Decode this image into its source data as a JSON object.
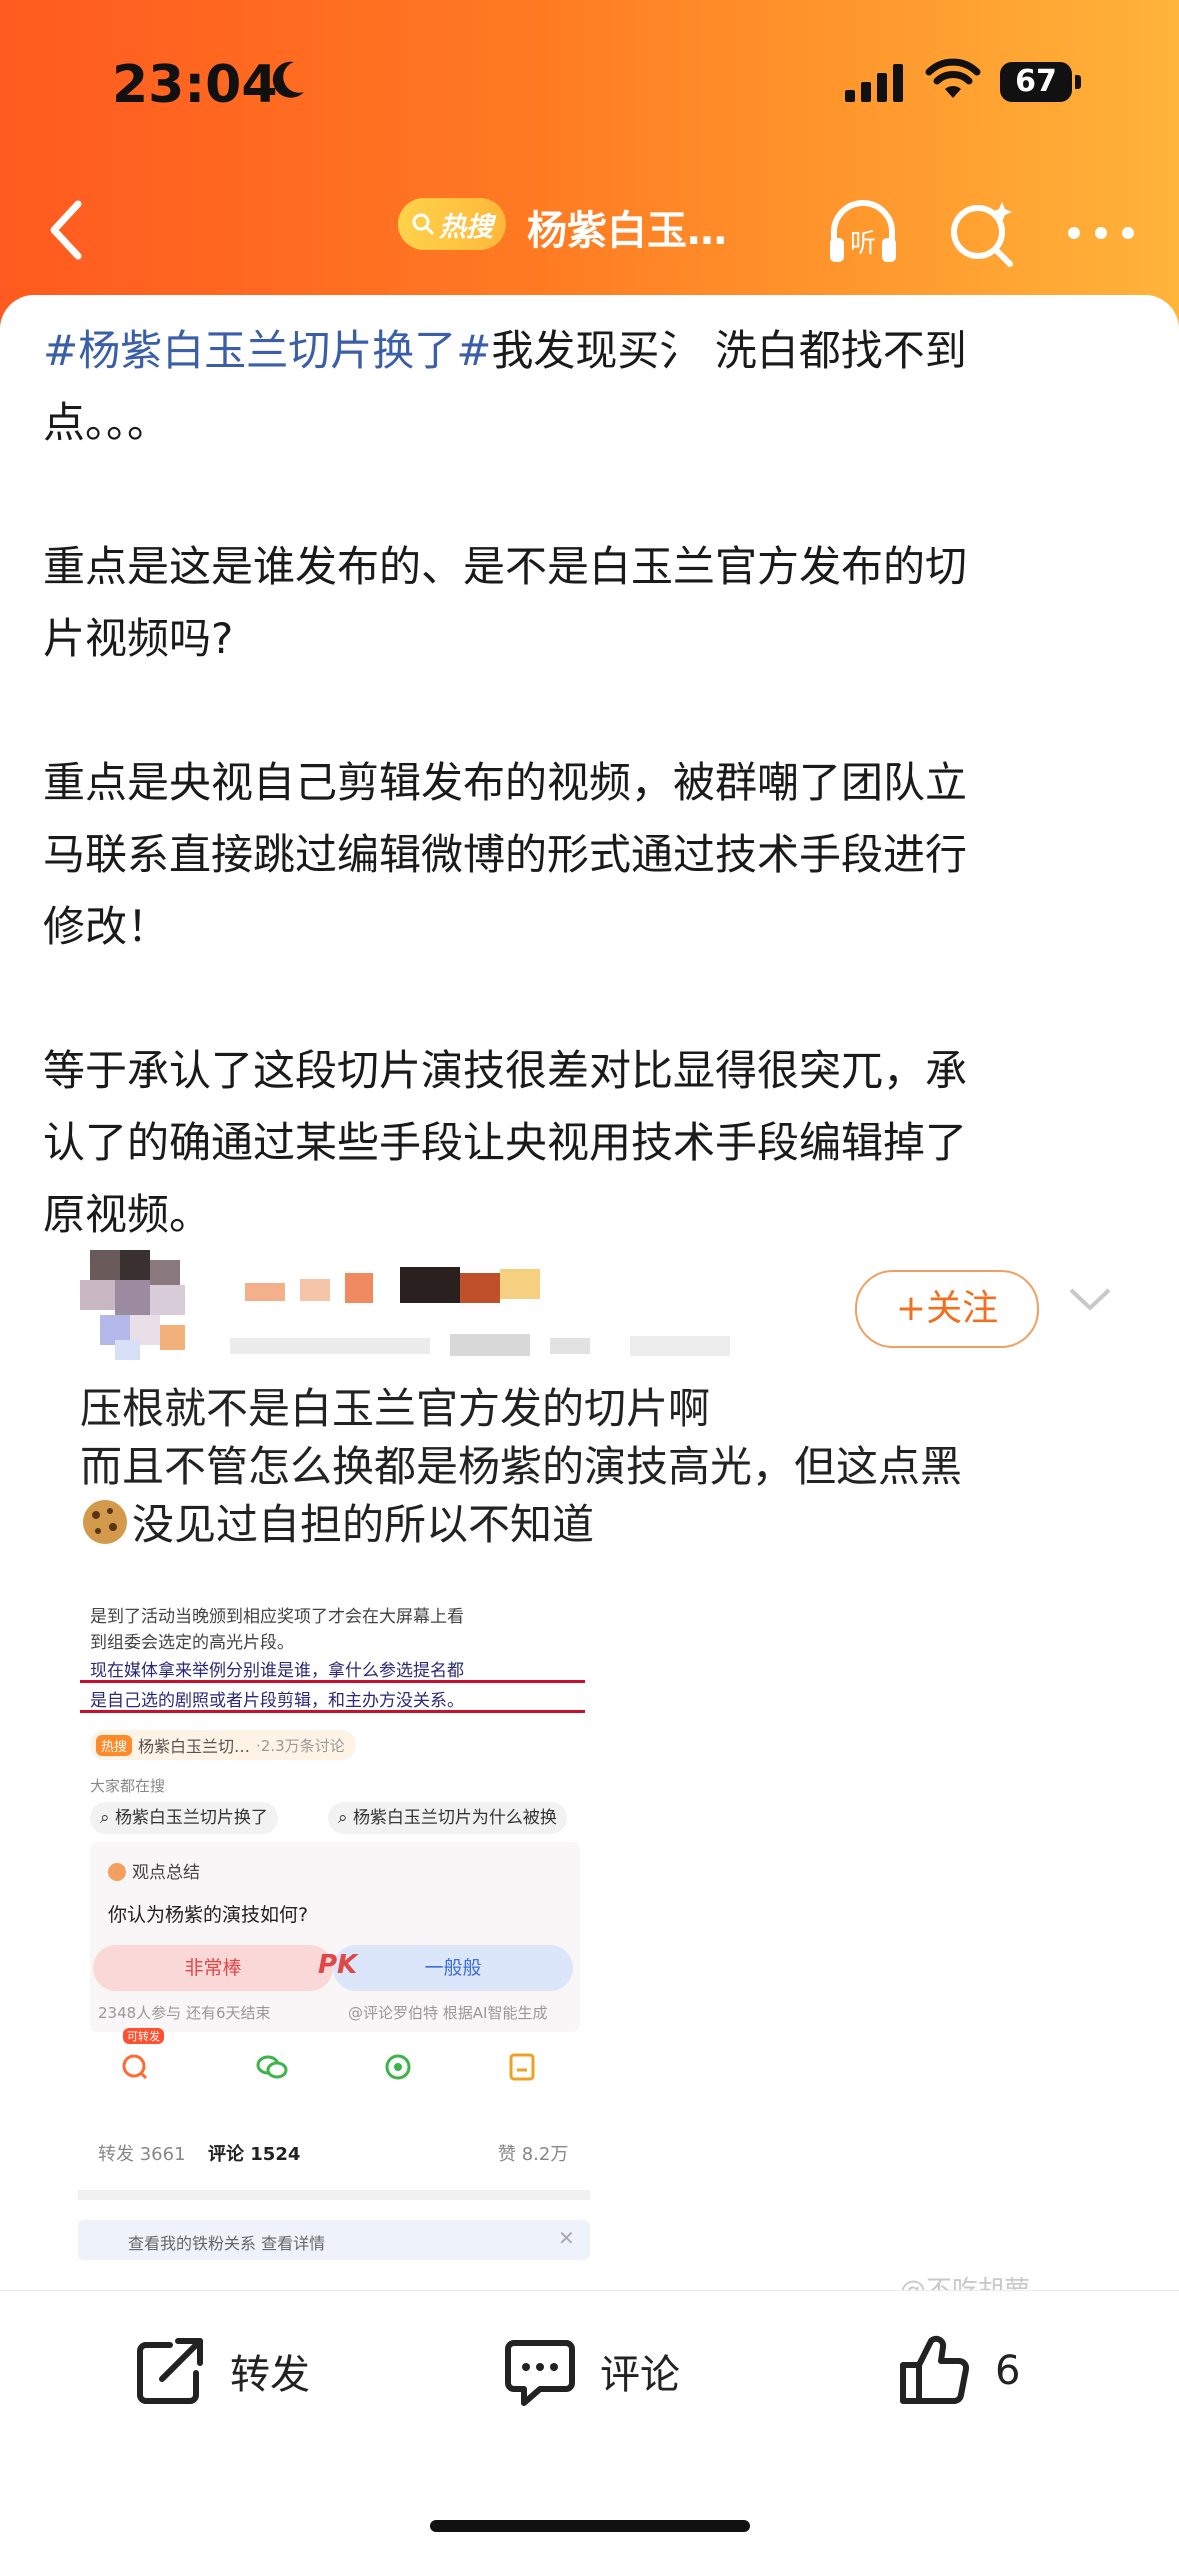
{
  "status_bar": {
    "time": "23:04",
    "battery": "67"
  },
  "nav": {
    "hot_badge": "热搜",
    "title": "杨紫白玉…",
    "listen_label": "听"
  },
  "post": {
    "p1_hashtag": "#杨紫白玉兰切片换了#",
    "p1_line1_rest": "我发现买氵 洗白都找不到",
    "p1_line2": "点。。。",
    "p2_line1": "重点是这是谁发布的、是不是白玉兰官方发布的切",
    "p2_line2": "片视频吗?",
    "p3_line1": "重点是央视自己剪辑发布的视频，被群嘲了团队立",
    "p3_line2": "马联系直接跳过编辑微博的形式通过技术手段进行",
    "p3_line3": "修改！",
    "p4_line1": "等于承认了这段切片演技很差对比显得很突兀，承",
    "p4_line2": "认了的确通过某些手段让央视用技术手段编辑掉了",
    "p4_line3": "原视频。"
  },
  "embed": {
    "follow_label": "+关注",
    "quote_line1": "压根就不是白玉兰官方发的切片啊",
    "quote_line2": "而且不管怎么换都是杨紫的演技高光，但这点黑",
    "quote_line3": "没见过自担的所以不知道",
    "inner": {
      "l1": "是到了活动当晚颁到相应奖项了才会在大屏幕上看",
      "l2": "到组委会选定的高光片段。",
      "l3": "现在媒体拿来举例分别谁是谁，拿什么参选提名都",
      "l4": "是自己选的剧照或者片段剪辑，和主办方没关系。",
      "topic_badge": "热搜",
      "topic_title": "杨紫白玉兰切…",
      "topic_count": "·2.3万条讨论",
      "search_header": "大家都在搜",
      "search_chip1": "杨紫白玉兰切片换了",
      "search_chip2": "杨紫白玉兰切片为什么被换",
      "opinion_title": "观点总结",
      "question": "你认为杨紫的演技如何?",
      "vote_left": "非常棒",
      "vote_pk": "PK",
      "vote_right": "一般般",
      "vote_stats": "2348人参与  还有6天结束",
      "vote_credit": "@评论罗伯特 根据AI智能生成",
      "share_badge": "可转发",
      "tab_repost": "转发 3661",
      "tab_comment": "评论 1524",
      "tab_like": "赞 8.2万",
      "notice": "查看我的铁粉关系 查看详情"
    }
  },
  "watermark": "@不吃胡萝",
  "actions": {
    "repost_label": "转发",
    "comment_label": "评论",
    "like_count": "6"
  }
}
